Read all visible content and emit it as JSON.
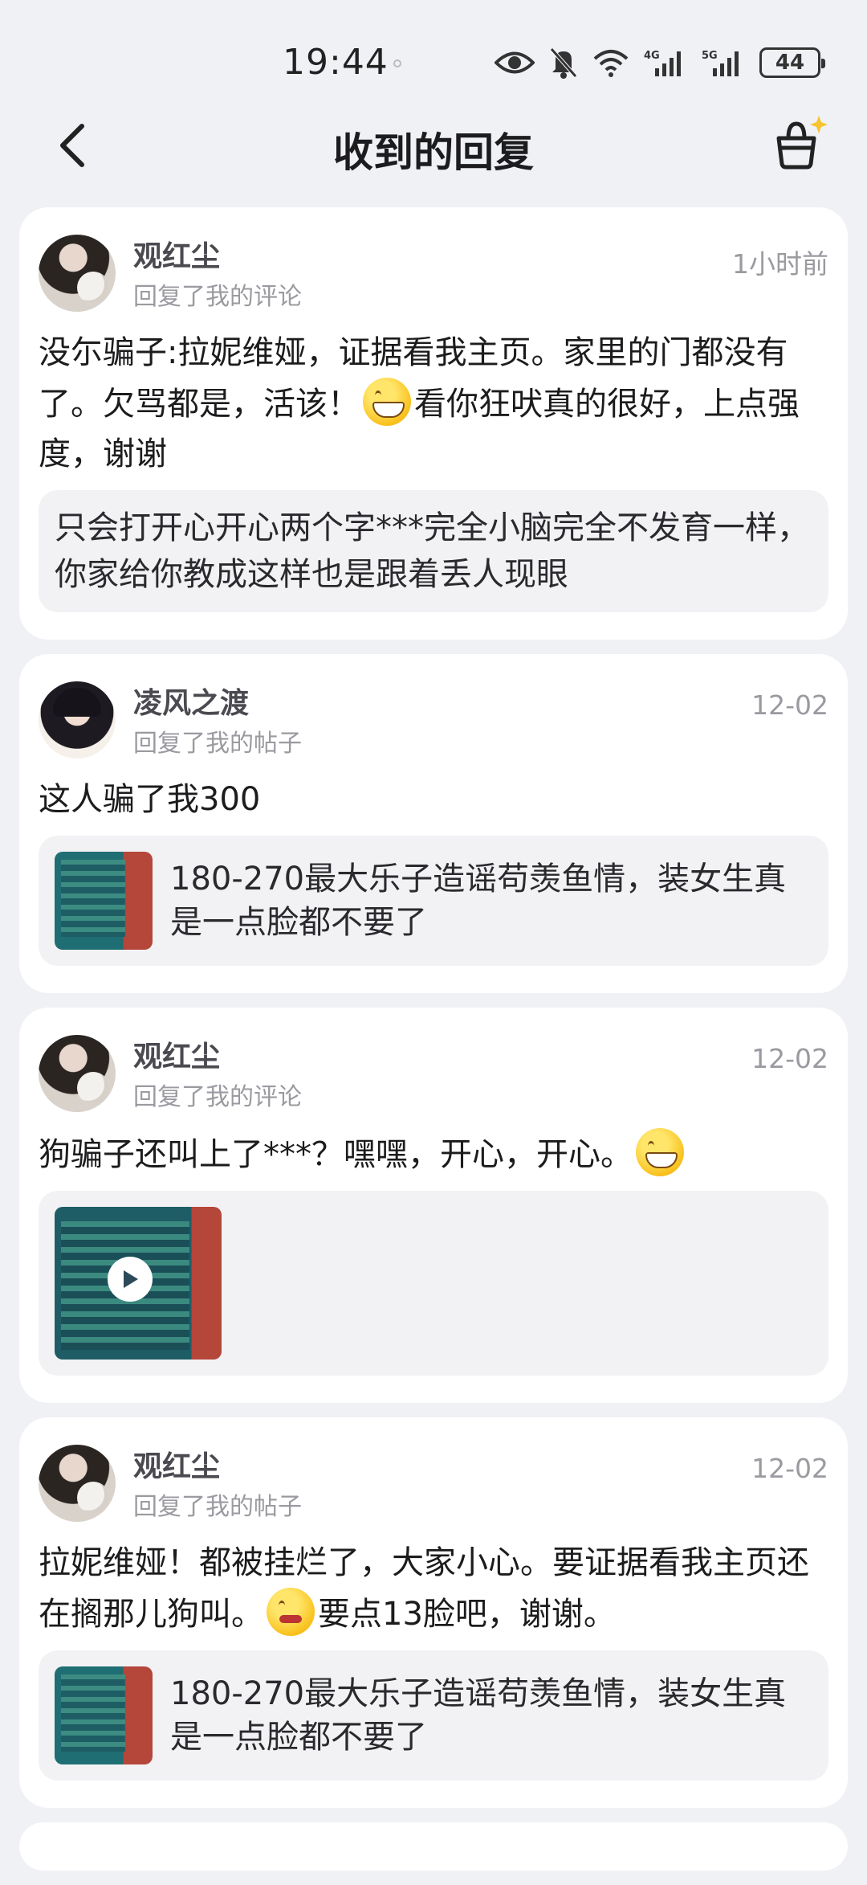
{
  "status_bar": {
    "time": "19:44",
    "battery": "44"
  },
  "header": {
    "title": "收到的回复"
  },
  "replies": [
    {
      "user": "观红尘",
      "action": "回复了我的评论",
      "time": "1小时前",
      "content_a": "没尓骗子:拉妮维娅，证据看我主页。家里的门都没有了。欠骂都是，活该！",
      "content_b": "看你狂吠真的很好，上点强度，谢谢",
      "quote": "只会打开心开心两个字***完全小脑完全不发育一样，你家给你教成这样也是跟着丢人现眼"
    },
    {
      "user": "凌风之渡",
      "action": "回复了我的帖子",
      "time": "12-02",
      "content": "这人骗了我300",
      "ref_title": "180-270最大乐子造谣苟羡鱼情，装女生真是一点脸都不要了"
    },
    {
      "user": "观红尘",
      "action": "回复了我的评论",
      "time": "12-02",
      "content": "狗骗子还叫上了***？嘿嘿，开心，开心。"
    },
    {
      "user": "观红尘",
      "action": "回复了我的帖子",
      "time": "12-02",
      "content_a": "拉妮维娅！都被挂烂了，大家小心。要证据看我主页还在搁那儿狗叫。",
      "content_b": "要点13脸吧，谢谢。",
      "ref_title": "180-270最大乐子造谣苟羡鱼情，装女生真是一点脸都不要了"
    }
  ]
}
